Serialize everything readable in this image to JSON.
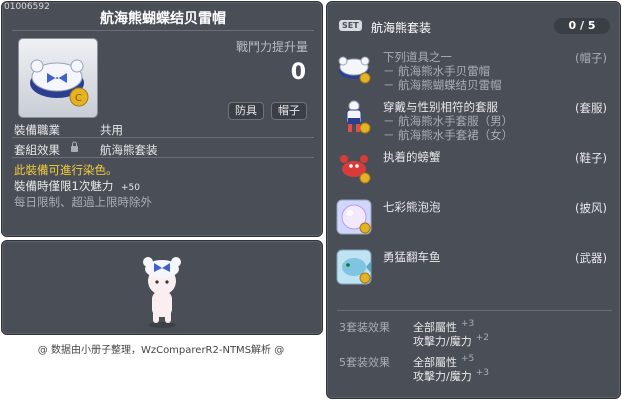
{
  "item": {
    "id": "01006592",
    "name": "航海熊蝴蝶结贝雷帽",
    "power_label": "戰鬥力提升量",
    "power_value": "0",
    "tags": [
      "防具",
      "帽子"
    ],
    "job_label": "裝備職業",
    "job_value": "共用",
    "set_label": "套組效果",
    "set_value": "航海熊套装",
    "dye_note": "此裝備可進行染色。",
    "equip_bonus_label": "裝備時僅限1次魅力",
    "equip_bonus_value": "+50",
    "limit_note": "每日限制、超過上限時除外"
  },
  "footer": "@ 数据由小册子整理，WzComparerR2-NTMS解析 @",
  "set": {
    "badge": "SET",
    "name": "航海熊套装",
    "count": "0 / 5",
    "items": [
      {
        "title": "下列道具之一",
        "subs": [
          "－ 航海熊水手贝雷帽",
          "－ 航海熊蝴蝶结贝雷帽"
        ],
        "category": "(帽子)",
        "icon": "hat-icon",
        "dimmed": true
      },
      {
        "title": "穿戴与性别相符的套服",
        "subs": [
          "－ 航海熊水手套服（男）",
          "－ 航海熊水手套裙（女）"
        ],
        "category": "(套服)",
        "icon": "outfit-icon",
        "dimmed": false
      },
      {
        "title": "执着的螃蟹",
        "subs": [],
        "category": "(鞋子)",
        "icon": "crab-shoes-icon",
        "dimmed": false
      },
      {
        "title": "七彩熊泡泡",
        "subs": [],
        "category": "(披风)",
        "icon": "bubble-cape-icon",
        "dimmed": false
      },
      {
        "title": "勇猛翻车鱼",
        "subs": [],
        "category": "(武器)",
        "icon": "fish-weapon-icon",
        "dimmed": false
      }
    ],
    "bonuses": [
      {
        "label": "3套装效果",
        "lines": [
          {
            "stat": "全部屬性",
            "val": "+3"
          },
          {
            "stat": "攻擊力/魔力",
            "val": "+2"
          }
        ]
      },
      {
        "label": "5套装效果",
        "lines": [
          {
            "stat": "全部屬性",
            "val": "+5"
          },
          {
            "stat": "攻擊力/魔力",
            "val": "+3"
          }
        ]
      }
    ]
  }
}
